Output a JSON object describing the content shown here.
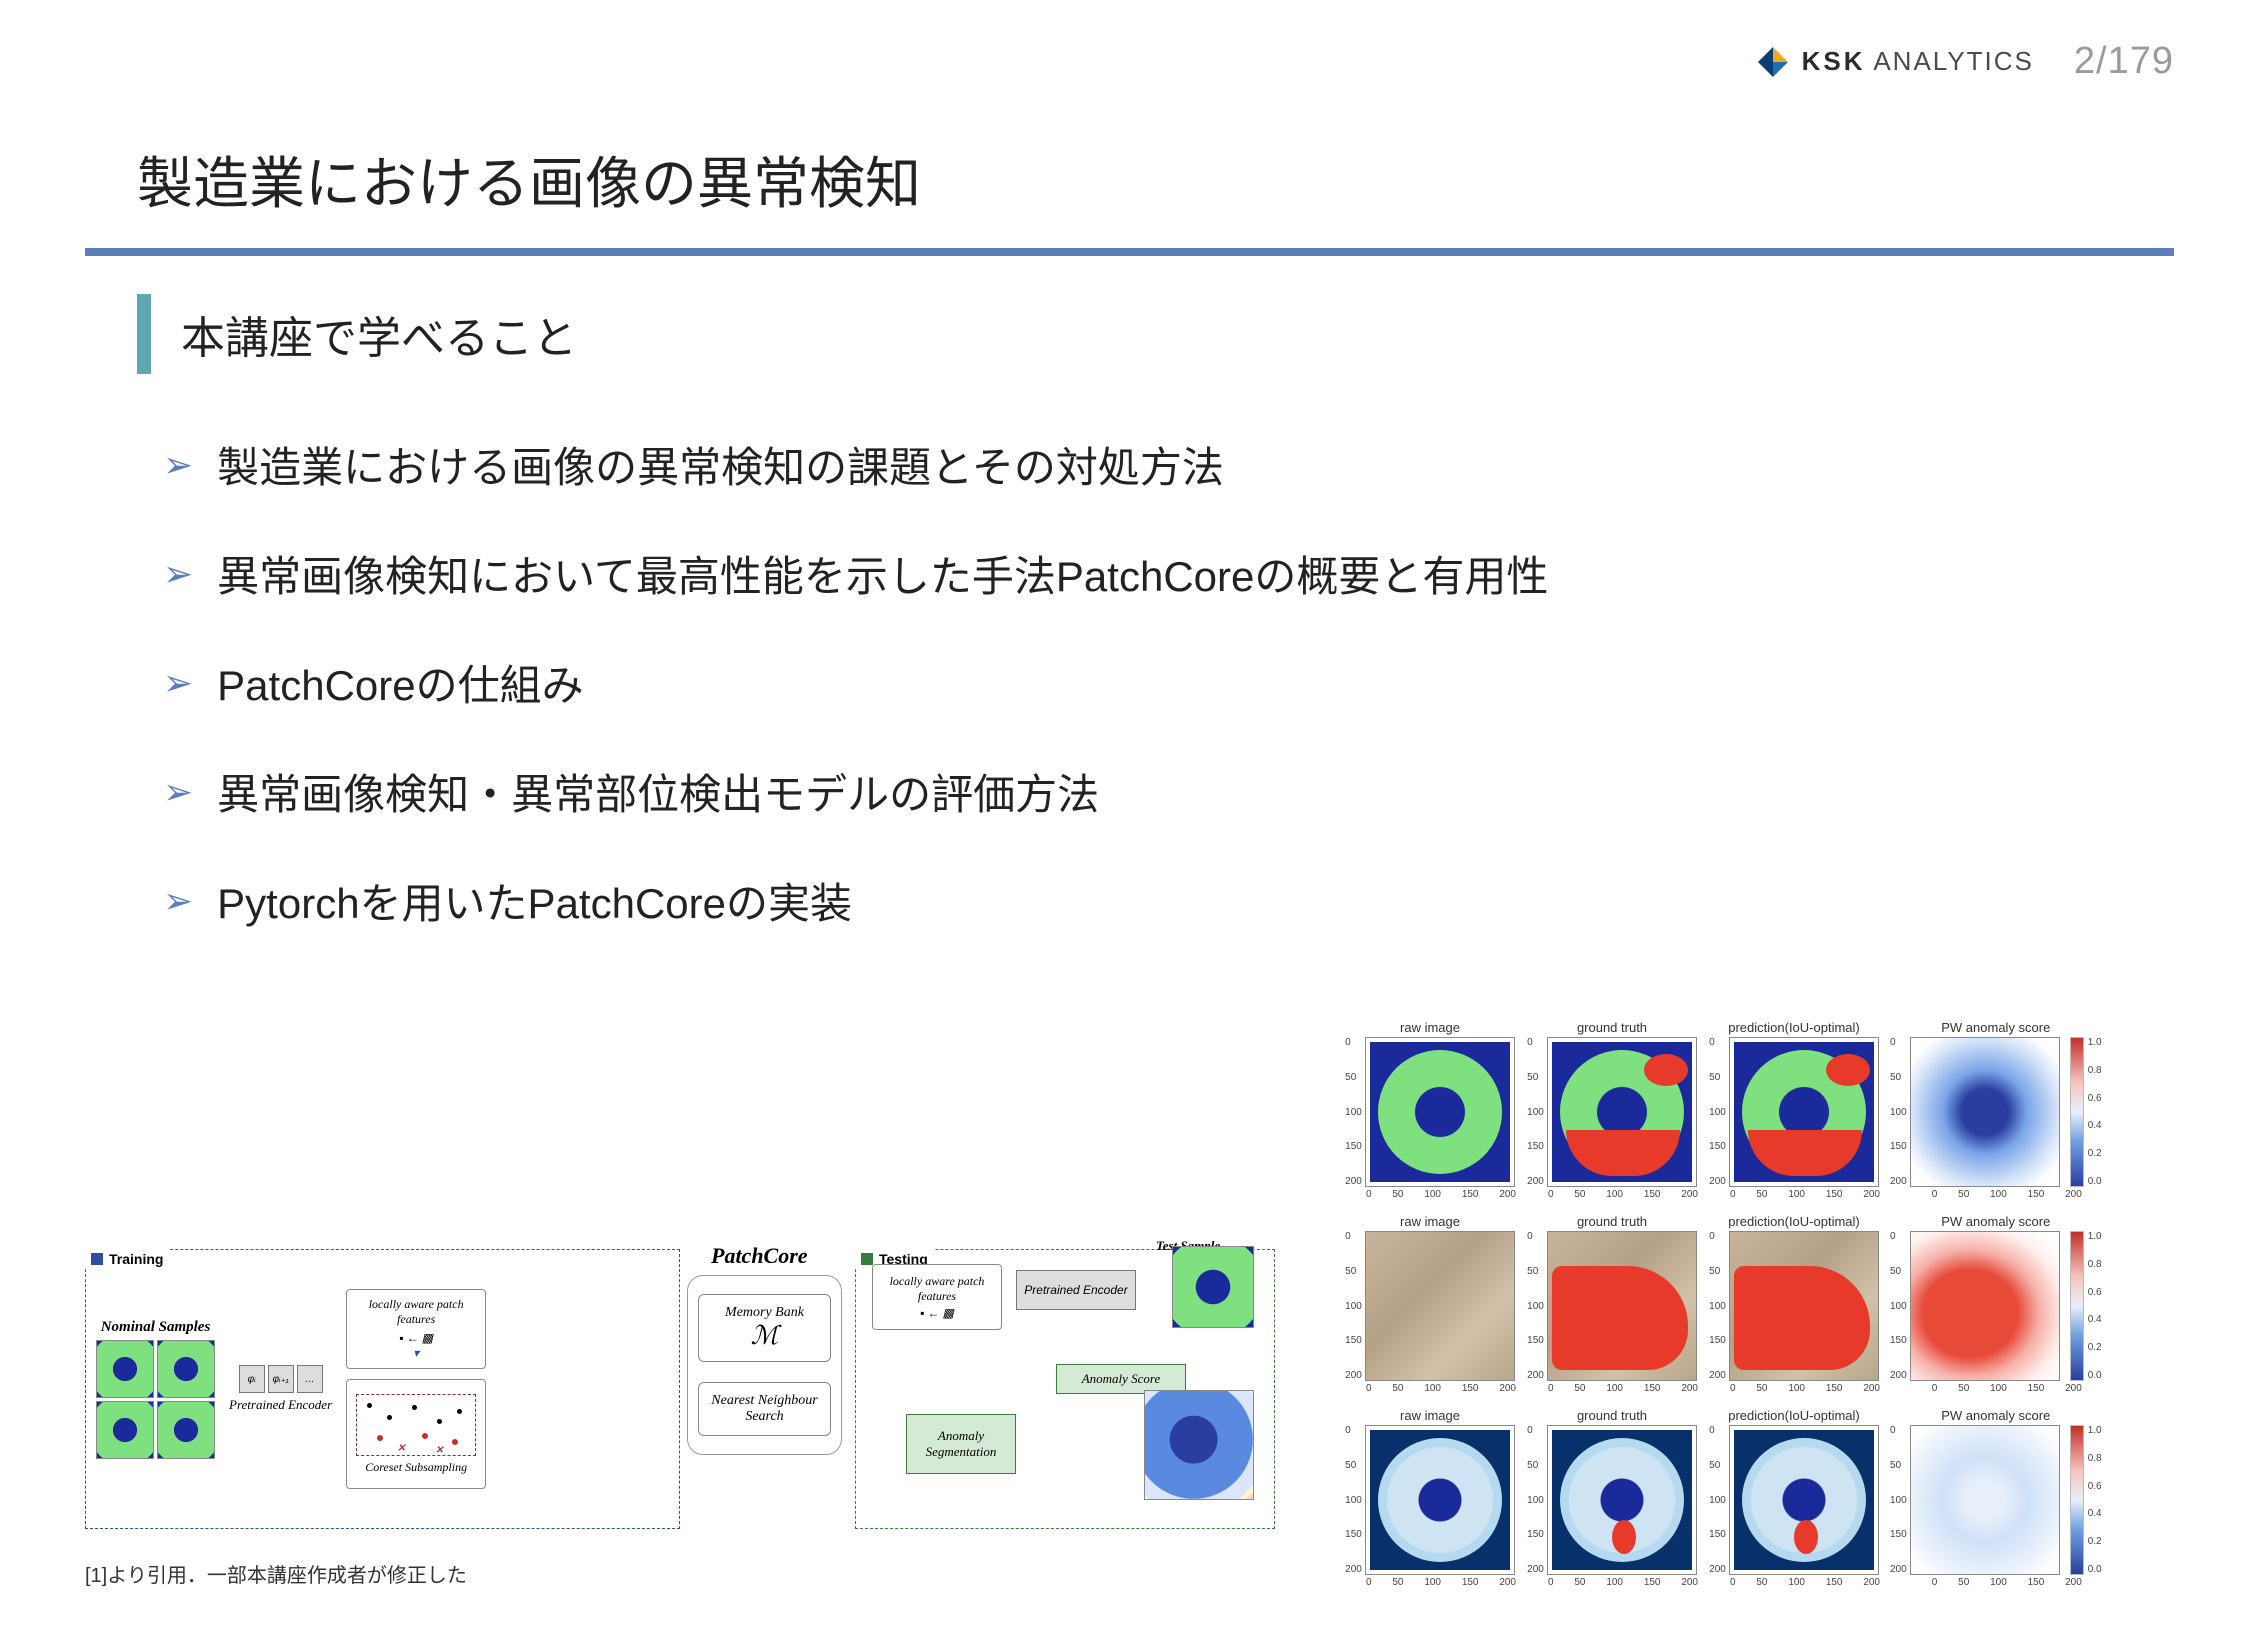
{
  "header": {
    "logo_text_bold": "KSK",
    "logo_text_rest": " ANALYTICS",
    "page_number": "2/179"
  },
  "title": "製造業における画像の異常検知",
  "subtitle": "本講座で学べること",
  "bullets": [
    "製造業における画像の異常検知の課題とその対処方法",
    "異常画像検知において最高性能を示した手法PatchCoreの概要と有用性",
    "PatchCoreの仕組み",
    "異常画像検知・異常部位検出モデルの評価方法",
    "Pytorchを用いたPatchCoreの実装"
  ],
  "diagram": {
    "training_label": "Training",
    "testing_label": "Testing",
    "patchcore_label": "PatchCore",
    "nominal_label": "Nominal Samples",
    "pretrained_encoder_label": "Pretrained Encoder",
    "locally_aware_label": "locally aware patch features",
    "coreset_label": "Coreset Subsampling",
    "memory_bank_label": "Memory Bank",
    "memory_bank_symbol": "ℳ",
    "nn_search_label": "Nearest Neighbour Search",
    "test_sample_label": "Test Sample",
    "anomaly_score_label": "Anomaly Score",
    "anomaly_seg_label": "Anomaly Segmentation",
    "encoder_phis": [
      "φᵢ",
      "φᵢ₊₁",
      "…"
    ]
  },
  "citation": "[1]より引用．一部本講座作成者が修正した",
  "grid": {
    "col_titles": [
      "raw image",
      "ground truth",
      "prediction(IoU-optimal)",
      "PW anomaly score"
    ],
    "y_ticks": [
      "0",
      "50",
      "100",
      "150",
      "200"
    ],
    "x_ticks": [
      "0",
      "50",
      "100",
      "150",
      "200"
    ],
    "cb_ticks": [
      "1.0",
      "0.8",
      "0.6",
      "0.4",
      "0.2",
      "0.0"
    ]
  }
}
